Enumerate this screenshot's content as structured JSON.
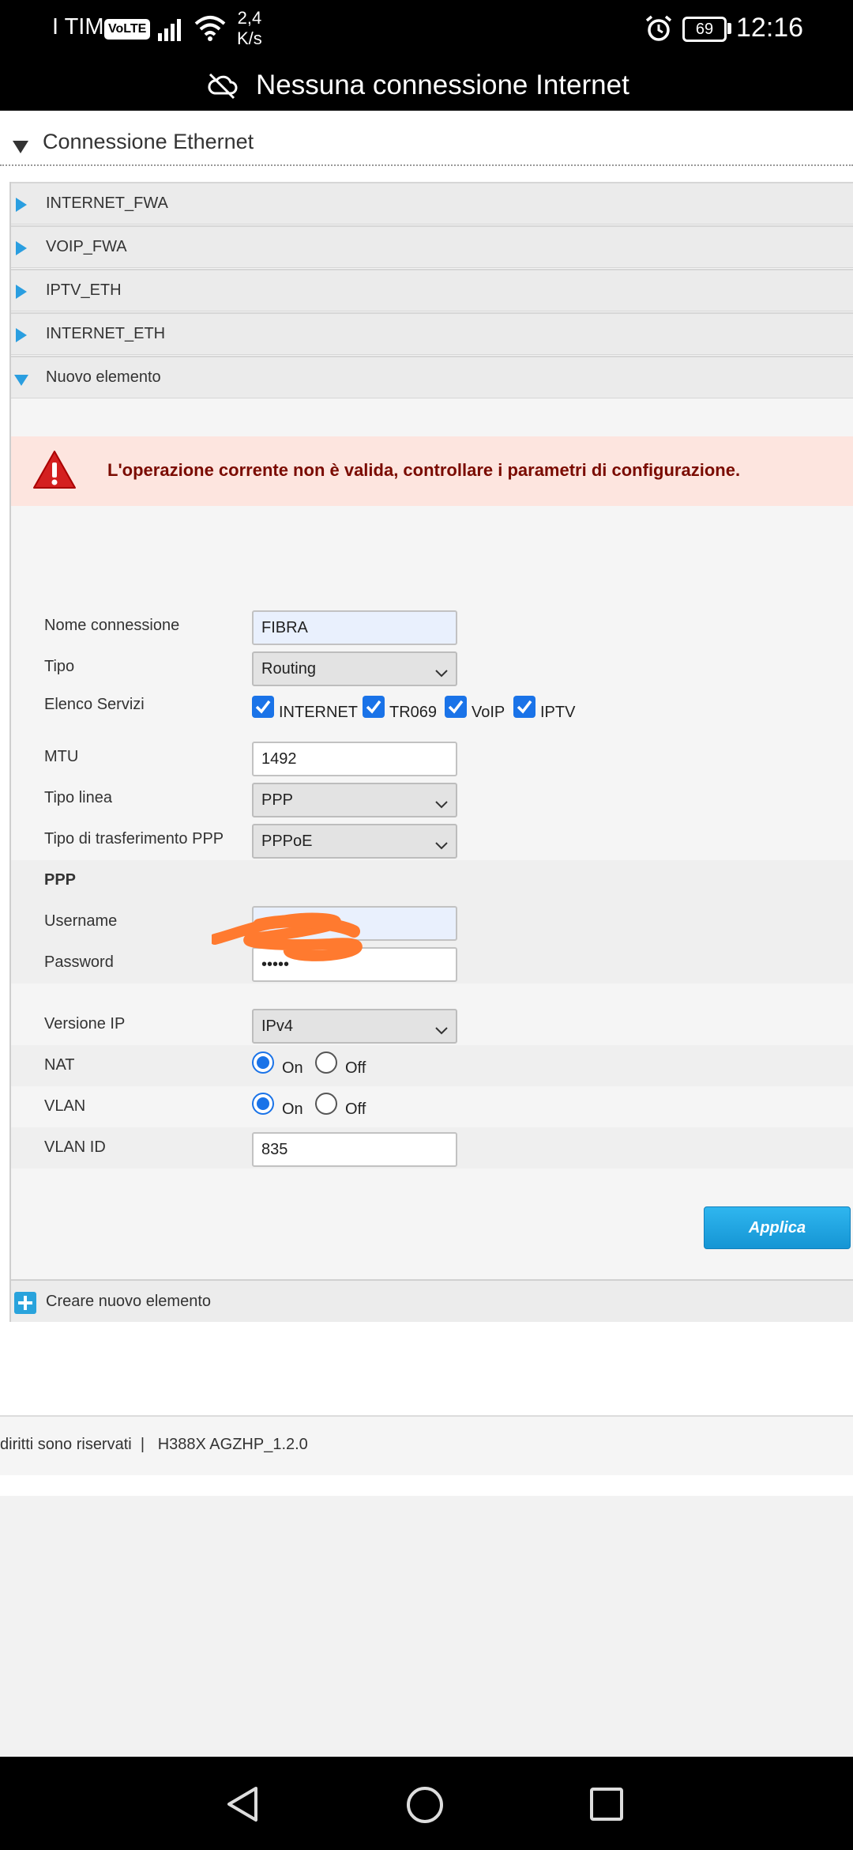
{
  "status_bar": {
    "carrier": "I TIM",
    "volte": "VoLTE",
    "speed_value": "2,4",
    "speed_unit": "K/s",
    "battery": "69",
    "time": "12:16"
  },
  "network_banner": "Nessuna connessione Internet",
  "section": {
    "title": "Connessione Ethernet"
  },
  "accordion": [
    {
      "label": "INTERNET_FWA"
    },
    {
      "label": "VOIP_FWA"
    },
    {
      "label": "IPTV_ETH"
    },
    {
      "label": "INTERNET_ETH"
    },
    {
      "label": "Nuovo elemento"
    }
  ],
  "error": {
    "message": "L'operazione corrente non è valida, controllare i parametri di configurazione."
  },
  "form": {
    "connection_name": {
      "label": "Nome connessione",
      "value": "FIBRA"
    },
    "type": {
      "label": "Tipo",
      "value": "Routing"
    },
    "services": {
      "label": "Elenco Servizi",
      "items": [
        {
          "label": "INTERNET",
          "checked": true
        },
        {
          "label": "TR069",
          "checked": true
        },
        {
          "label": "VoIP",
          "checked": true
        },
        {
          "label": "IPTV",
          "checked": true
        }
      ]
    },
    "mtu": {
      "label": "MTU",
      "value": "1492"
    },
    "line_type": {
      "label": "Tipo linea",
      "value": "PPP"
    },
    "ppp_transfer": {
      "label": "Tipo di trasferimento PPP",
      "value": "PPPoE"
    },
    "ppp_section": "PPP",
    "username": {
      "label": "Username",
      "value": ""
    },
    "password": {
      "label": "Password",
      "value": "•••••"
    },
    "ip_version": {
      "label": "Versione IP",
      "value": "IPv4"
    },
    "nat": {
      "label": "NAT",
      "on": "On",
      "off": "Off",
      "selected": "On"
    },
    "vlan": {
      "label": "VLAN",
      "on": "On",
      "off": "Off",
      "selected": "On"
    },
    "vlan_id": {
      "label": "VLAN ID",
      "value": "835"
    }
  },
  "apply_button": "Applica",
  "create_new": "Creare nuovo elemento",
  "footer": {
    "text": "diritti sono riservati  |   H388X AGZHP_1.2.0"
  },
  "colors": {
    "accent_blue": "#2a9ee0",
    "error_bg": "#fde5df",
    "error_text": "#7a0b00",
    "scribble": "#ff7a2f"
  }
}
